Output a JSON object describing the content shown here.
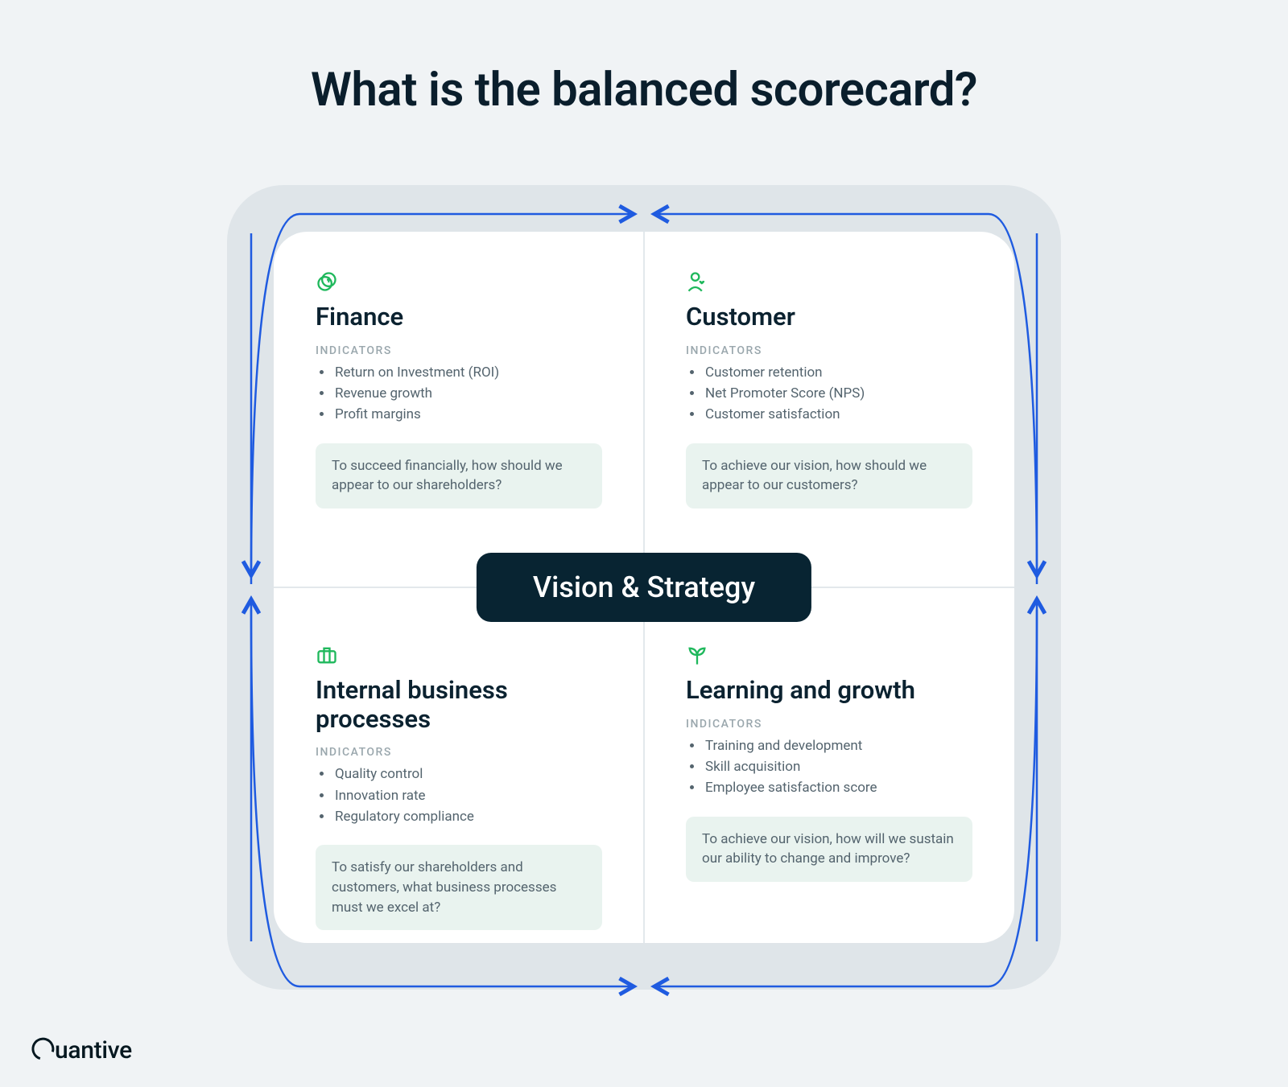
{
  "title": "What is the balanced scorecard?",
  "center_label": "Vision & Strategy",
  "indicators_label": "INDICATORS",
  "quadrants": {
    "finance": {
      "title": "Finance",
      "indicators": [
        "Return on Investment (ROI)",
        "Revenue growth",
        "Profit margins"
      ],
      "question": "To succeed financially, how should we appear to our shareholders?"
    },
    "customer": {
      "title": "Customer",
      "indicators": [
        "Customer retention",
        "Net Promoter Score (NPS)",
        "Customer satisfaction"
      ],
      "question": "To achieve our vision, how should we appear to our customers?"
    },
    "internal": {
      "title": "Internal business processes",
      "indicators": [
        "Quality control",
        "Innovation rate",
        "Regulatory compliance"
      ],
      "question": "To satisfy our shareholders and customers, what business processes must we excel at?"
    },
    "learning": {
      "title": "Learning and growth",
      "indicators": [
        "Training and development",
        "Skill acquisition",
        "Employee satisfaction score"
      ],
      "question": "To achieve our vision, how will we sustain our ability to change and improve?"
    }
  },
  "brand": "uantive"
}
